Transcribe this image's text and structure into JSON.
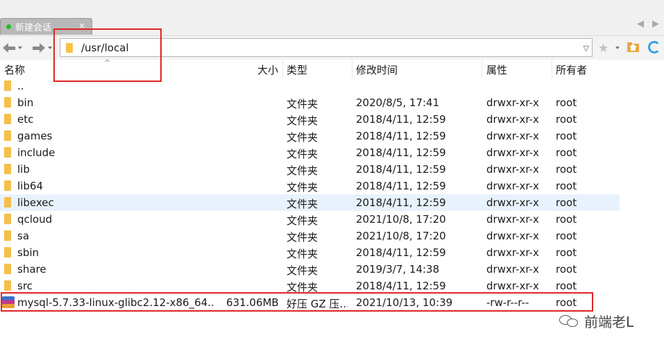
{
  "tab": {
    "label": "新建会话",
    "close": "×"
  },
  "tab_nav": {
    "prev": "◀",
    "next": "▶"
  },
  "address": {
    "path": "/usr/local",
    "dropdown": "▽"
  },
  "sort_indicator": "^",
  "columns": {
    "name": "名称",
    "size": "大小",
    "type": "类型",
    "modified": "修改时间",
    "attrs": "属性",
    "owner": "所有者"
  },
  "files": [
    {
      "name": "..",
      "size": "",
      "type": "",
      "modified": "",
      "attrs": "",
      "owner": ""
    },
    {
      "name": "bin",
      "size": "",
      "type": "文件夹",
      "modified": "2020/8/5, 17:41",
      "attrs": "drwxr-xr-x",
      "owner": "root"
    },
    {
      "name": "etc",
      "size": "",
      "type": "文件夹",
      "modified": "2018/4/11, 12:59",
      "attrs": "drwxr-xr-x",
      "owner": "root"
    },
    {
      "name": "games",
      "size": "",
      "type": "文件夹",
      "modified": "2018/4/11, 12:59",
      "attrs": "drwxr-xr-x",
      "owner": "root"
    },
    {
      "name": "include",
      "size": "",
      "type": "文件夹",
      "modified": "2018/4/11, 12:59",
      "attrs": "drwxr-xr-x",
      "owner": "root"
    },
    {
      "name": "lib",
      "size": "",
      "type": "文件夹",
      "modified": "2018/4/11, 12:59",
      "attrs": "drwxr-xr-x",
      "owner": "root"
    },
    {
      "name": "lib64",
      "size": "",
      "type": "文件夹",
      "modified": "2018/4/11, 12:59",
      "attrs": "drwxr-xr-x",
      "owner": "root"
    },
    {
      "name": "libexec",
      "size": "",
      "type": "文件夹",
      "modified": "2018/4/11, 12:59",
      "attrs": "drwxr-xr-x",
      "owner": "root"
    },
    {
      "name": "qcloud",
      "size": "",
      "type": "文件夹",
      "modified": "2021/10/8, 17:20",
      "attrs": "drwxr-xr-x",
      "owner": "root"
    },
    {
      "name": "sa",
      "size": "",
      "type": "文件夹",
      "modified": "2021/10/8, 17:20",
      "attrs": "drwxr-xr-x",
      "owner": "root"
    },
    {
      "name": "sbin",
      "size": "",
      "type": "文件夹",
      "modified": "2018/4/11, 12:59",
      "attrs": "drwxr-xr-x",
      "owner": "root"
    },
    {
      "name": "share",
      "size": "",
      "type": "文件夹",
      "modified": "2019/3/7, 14:38",
      "attrs": "drwxr-xr-x",
      "owner": "root"
    },
    {
      "name": "src",
      "size": "",
      "type": "文件夹",
      "modified": "2018/4/11, 12:59",
      "attrs": "drwxr-xr-x",
      "owner": "root"
    },
    {
      "name": "mysql-5.7.33-linux-glibc2.12-x86_64....",
      "size": "631.06MB",
      "type": "好压 GZ 压...",
      "modified": "2021/10/13, 10:39",
      "attrs": "-rw-r--r--",
      "owner": "root"
    }
  ],
  "watermark": "前端老L",
  "colors": {
    "folder": "#f4c04a",
    "selected_row": "#e8f2fc",
    "highlight_box": "#e02424"
  }
}
